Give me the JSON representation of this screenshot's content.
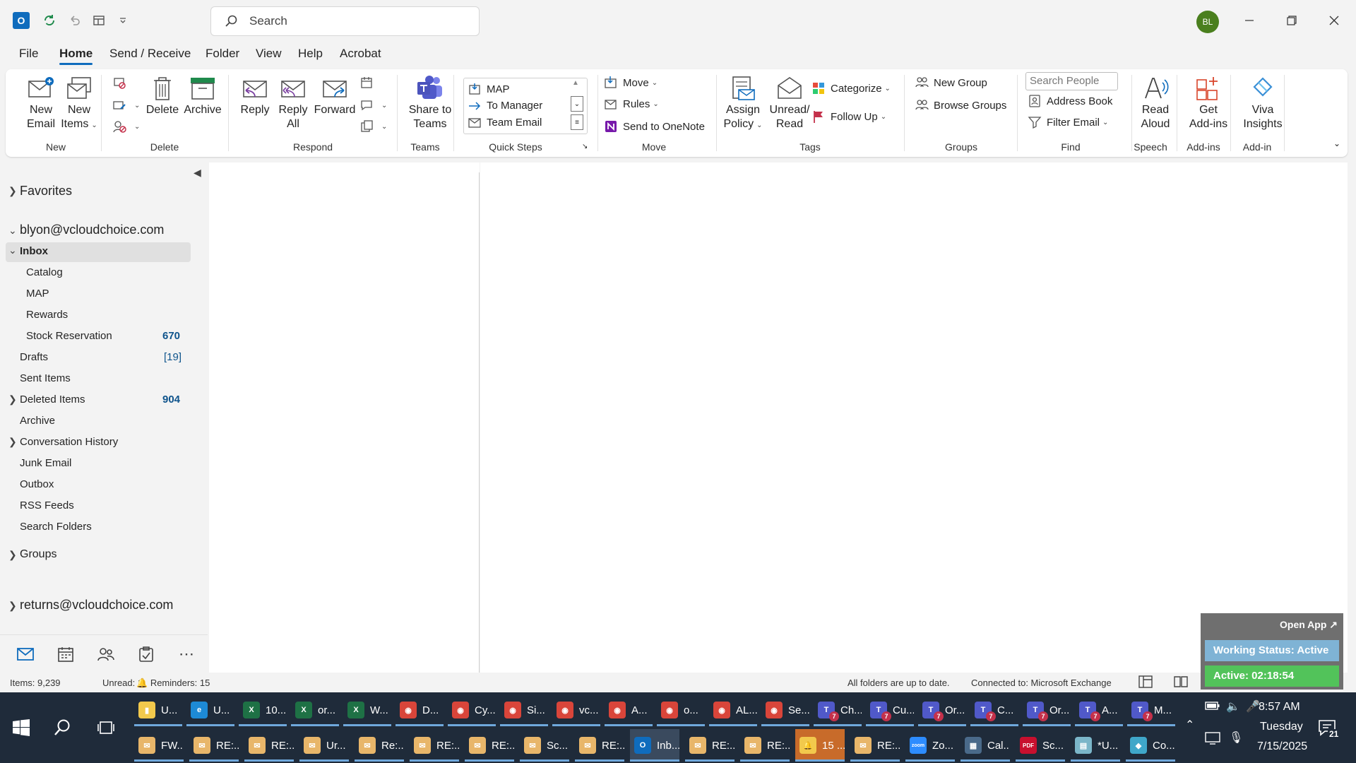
{
  "titlebar": {
    "search_placeholder": "Search",
    "avatar_initials": "BL"
  },
  "menu": {
    "tabs": [
      "File",
      "Home",
      "Send / Receive",
      "Folder",
      "View",
      "Help",
      "Acrobat"
    ],
    "active": "Home"
  },
  "ribbon": {
    "new_email": "New\nEmail",
    "new_items": "New\nItems",
    "delete": "Delete",
    "archive": "Archive",
    "reply": "Reply",
    "reply_all": "Reply\nAll",
    "forward": "Forward",
    "share_to_teams": "Share to\nTeams",
    "quick_steps": [
      "MAP",
      "To Manager",
      "Team Email"
    ],
    "move": "Move",
    "rules": "Rules",
    "send_to_onenote": "Send to OneNote",
    "assign_policy": "Assign\nPolicy",
    "unread_read": "Unread/\nRead",
    "categorize": "Categorize",
    "follow_up": "Follow Up",
    "new_group": "New Group",
    "browse_groups": "Browse Groups",
    "search_people_placeholder": "Search People",
    "address_book": "Address Book",
    "filter_email": "Filter Email",
    "read_aloud": "Read\nAloud",
    "get_addins": "Get\nAdd-ins",
    "viva_insights": "Viva\nInsights",
    "groups": {
      "new": "New",
      "delete": "Delete",
      "respond": "Respond",
      "teams": "Teams",
      "quick_steps": "Quick Steps",
      "move": "Move",
      "tags": "Tags",
      "groups": "Groups",
      "find": "Find",
      "speech": "Speech",
      "addins": "Add-ins",
      "addin": "Add-in"
    }
  },
  "folders": {
    "favorites": "Favorites",
    "account": "blyon@vcloudchoice.com",
    "inbox": "Inbox",
    "subfolders": [
      {
        "name": "Catalog",
        "count": ""
      },
      {
        "name": "MAP",
        "count": ""
      },
      {
        "name": "Rewards",
        "count": ""
      },
      {
        "name": "Stock Reservation",
        "count": "670"
      }
    ],
    "items": [
      {
        "name": "Drafts",
        "count": "[19]"
      },
      {
        "name": "Sent Items",
        "count": ""
      },
      {
        "name": "Deleted Items",
        "count": "904"
      },
      {
        "name": "Archive",
        "count": ""
      },
      {
        "name": "Conversation History",
        "count": ""
      },
      {
        "name": "Junk Email",
        "count": ""
      },
      {
        "name": "Outbox",
        "count": ""
      },
      {
        "name": "RSS Feeds",
        "count": ""
      },
      {
        "name": "Search Folders",
        "count": ""
      }
    ],
    "groups": "Groups",
    "account2": "returns@vcloudchoice.com"
  },
  "statusbar": {
    "items": "Items: 9,239",
    "unread": "Unread: 1",
    "reminders": "Reminders: 15",
    "sync": "All folders are up to date.",
    "connection": "Connected to: Microsoft Exchange"
  },
  "overlay": {
    "open_app": "Open App ↗",
    "working_status": "Working Status: Active",
    "active_timer": "Active: 02:18:54"
  },
  "taskbar": {
    "row1": [
      {
        "label": "U...",
        "icon": "folder",
        "color": "#f2c94c"
      },
      {
        "label": "U...",
        "icon": "E",
        "color": "#1d8ad6"
      },
      {
        "label": "10...",
        "icon": "X",
        "color": "#1e7145"
      },
      {
        "label": "or...",
        "icon": "X",
        "color": "#1e7145"
      },
      {
        "label": "W...",
        "icon": "X",
        "color": "#1e7145"
      },
      {
        "label": "D...",
        "icon": "chrome",
        "color": "#d9453a"
      },
      {
        "label": "Cy...",
        "icon": "chrome",
        "color": "#d9453a"
      },
      {
        "label": "Si...",
        "icon": "chrome",
        "color": "#d9453a"
      },
      {
        "label": "vc...",
        "icon": "chrome",
        "color": "#d9453a"
      },
      {
        "label": "A...",
        "icon": "chrome",
        "color": "#d9453a"
      },
      {
        "label": "o...",
        "icon": "chrome",
        "color": "#d9453a"
      },
      {
        "label": "AL...",
        "icon": "chrome",
        "color": "#d9453a"
      },
      {
        "label": "Se...",
        "icon": "chrome",
        "color": "#d9453a"
      },
      {
        "label": "Ch...",
        "icon": "T",
        "color": "#5059c9"
      },
      {
        "label": "Cu...",
        "icon": "T",
        "color": "#5059c9"
      },
      {
        "label": "Or...",
        "icon": "T",
        "color": "#5059c9"
      },
      {
        "label": "C...",
        "icon": "T",
        "color": "#5059c9"
      },
      {
        "label": "Or...",
        "icon": "T",
        "color": "#5059c9"
      },
      {
        "label": "A...",
        "icon": "T",
        "color": "#5059c9"
      },
      {
        "label": "M...",
        "icon": "T",
        "color": "#5059c9"
      }
    ],
    "row2": [
      {
        "label": "FW...",
        "icon": "mail",
        "color": "#e8b66a"
      },
      {
        "label": "RE:...",
        "icon": "mail",
        "color": "#e8b66a"
      },
      {
        "label": "RE:...",
        "icon": "mail",
        "color": "#e8b66a"
      },
      {
        "label": "Ur...",
        "icon": "mail",
        "color": "#e8b66a"
      },
      {
        "label": "Re:...",
        "icon": "mail",
        "color": "#e8b66a"
      },
      {
        "label": "RE:...",
        "icon": "mail",
        "color": "#e8b66a"
      },
      {
        "label": "RE:...",
        "icon": "mail",
        "color": "#e8b66a"
      },
      {
        "label": "Sc...",
        "icon": "mail",
        "color": "#e8b66a"
      },
      {
        "label": "RE:...",
        "icon": "mail",
        "color": "#e8b66a"
      },
      {
        "label": "Inb...",
        "icon": "O",
        "color": "#0f6cbd"
      },
      {
        "label": "RE:...",
        "icon": "mail",
        "color": "#e8b66a"
      },
      {
        "label": "RE:...",
        "icon": "mail",
        "color": "#e8b66a"
      },
      {
        "label": "15 ...",
        "icon": "bell",
        "color": "#f2c94c"
      },
      {
        "label": "RE:...",
        "icon": "mail",
        "color": "#e8b66a"
      },
      {
        "label": "Zo...",
        "icon": "zoom",
        "color": "#2d8cff"
      },
      {
        "label": "Cal...",
        "icon": "calc",
        "color": "#4a6a8a"
      },
      {
        "label": "Sc...",
        "icon": "pdf",
        "color": "#c8102e"
      },
      {
        "label": "*U...",
        "icon": "note",
        "color": "#7bb6c9"
      },
      {
        "label": "Co...",
        "icon": "co",
        "color": "#3fa7c9"
      }
    ],
    "time": "8:57 AM",
    "day": "Tuesday",
    "date": "7/15/2025",
    "notifications": "21"
  }
}
